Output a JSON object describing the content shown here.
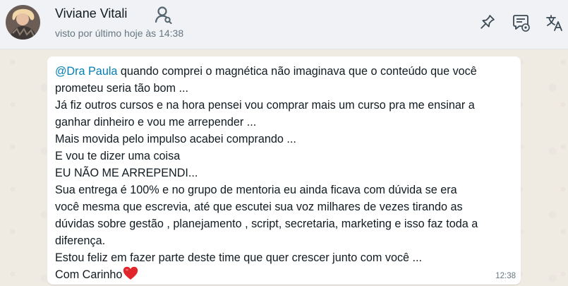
{
  "header": {
    "contact_name": "Viviane Vitali",
    "last_seen": "visto por último hoje às 14:38",
    "icons": [
      "group-icon",
      "pin-icon",
      "chat-settings-icon",
      "translate-icon"
    ]
  },
  "message": {
    "mention": "@Dra Paula",
    "line_1_rest": " quando comprei o magnética não imaginava que o conteúdo que você",
    "lines": [
      "prometeu seria tão bom ...",
      "Já fiz outros cursos e na hora pensei vou comprar mais um curso pra me ensinar a",
      "ganhar dinheiro e vou me arrepender ...",
      "Mais movida pelo impulso acabei comprando ...",
      "E vou te dizer uma coisa",
      "EU NÃO ME ARREPENDI...",
      "Sua entrega é 100% e no grupo de mentoria eu ainda ficava com dúvida se era",
      "você mesma que escrevia, até que escutei sua voz milhares de vezes tirando as",
      "dúvidas sobre gestão , planejamento , script, secretaria, marketing e isso faz toda a",
      "diferença.",
      "Estou feliz em fazer parte deste time que quer crescer junto com você ..."
    ],
    "closing": "Com Carinho",
    "closing_emoji": "red-heart-icon",
    "time": "12:38"
  },
  "colors": {
    "header_bg": "#f0f2f5",
    "chat_bg": "#efeae2",
    "bubble_bg": "#ffffff",
    "mention": "#027eb5",
    "text": "#111b21",
    "muted": "#667781",
    "icon": "#54656f",
    "heart": "#e0262b"
  }
}
